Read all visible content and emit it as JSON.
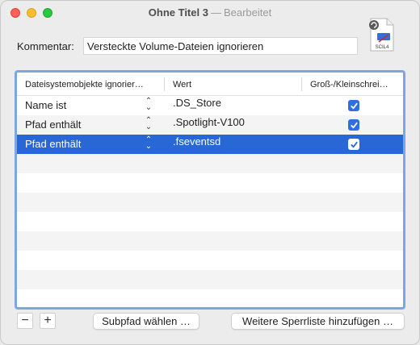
{
  "window": {
    "title": "Ohne Titel 3",
    "separator": "—",
    "state": "Bearbeitet"
  },
  "doc_icon": {
    "name": "document-icon",
    "label": "SCIL4"
  },
  "comment": {
    "label": "Kommentar:",
    "value": "Versteckte Volume-Dateien ignorieren"
  },
  "table": {
    "columns": [
      "Dateisystemobjekte ignorier…",
      "Wert",
      "Groß-/Kleinschrei…"
    ],
    "rows": [
      {
        "type": "Name ist",
        "value": ".DS_Store",
        "case_sensitive": true,
        "selected": false
      },
      {
        "type": "Pfad enthält",
        "value": ".Spotlight-V100",
        "case_sensitive": true,
        "selected": false
      },
      {
        "type": "Pfad enthält",
        "value": ".fseventsd",
        "case_sensitive": true,
        "selected": true
      }
    ]
  },
  "buttons": {
    "remove": "−",
    "add": "+",
    "subpath": "Subpfad wählen …",
    "more": "Weitere Sperrliste hinzufügen …"
  },
  "colors": {
    "selection": "#2867d6",
    "accent": "#2f6fe0",
    "table_border": "#7fa4e3"
  }
}
